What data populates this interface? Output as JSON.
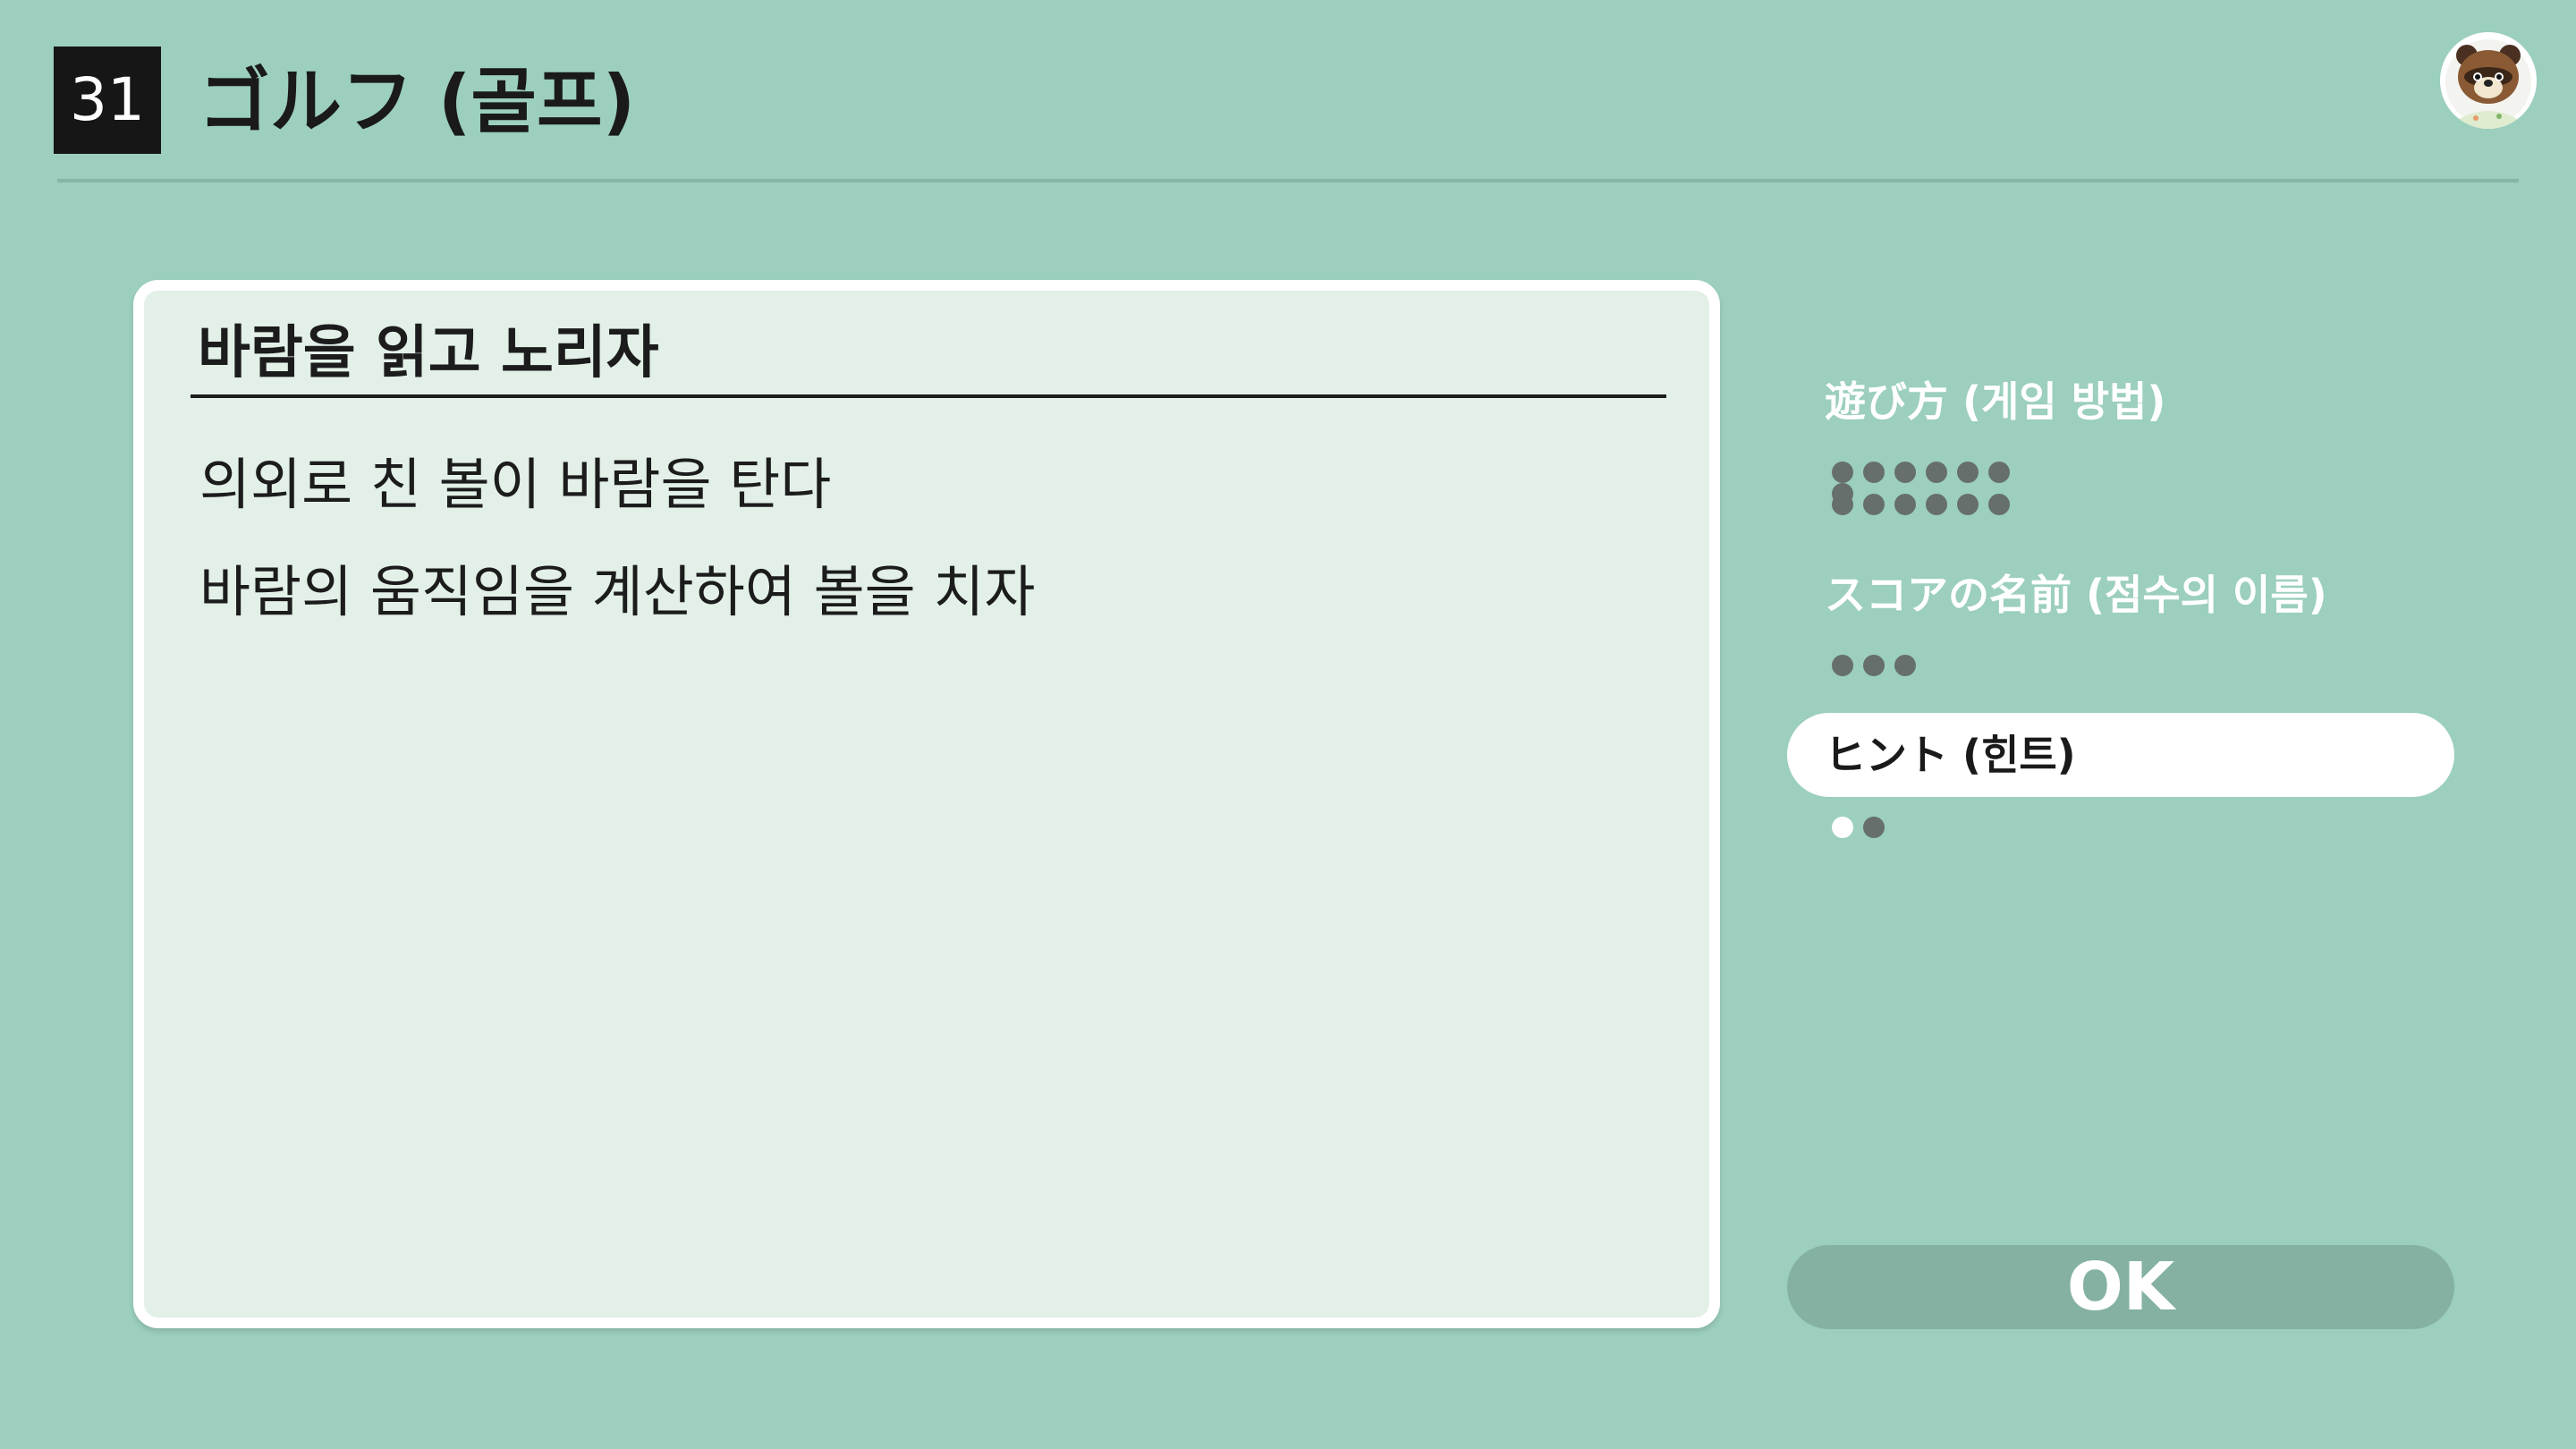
{
  "header": {
    "number": "31",
    "title": "ゴルフ (골프)"
  },
  "panel": {
    "heading": "바람을 읽고 노리자",
    "lines": [
      "의외로 친 볼이 바람을 탄다",
      "바람의 움직임을 계산하여 볼을 치자"
    ]
  },
  "menu": {
    "items": [
      {
        "label": "遊び方 (게임 방법)",
        "selected": false
      },
      {
        "label": "スコアの名前 (점수의 이름)",
        "selected": false
      },
      {
        "label": "ヒント (힌트)",
        "selected": true
      }
    ],
    "ok_label": "OK"
  },
  "colors": {
    "background": "#9ccfbd",
    "panel": "#e2f0e7",
    "badge": "#161616",
    "ok_button": "#84b1a2",
    "dot": "#666f6b"
  },
  "icons": {
    "avatar": "tom-nook-avatar-icon"
  }
}
